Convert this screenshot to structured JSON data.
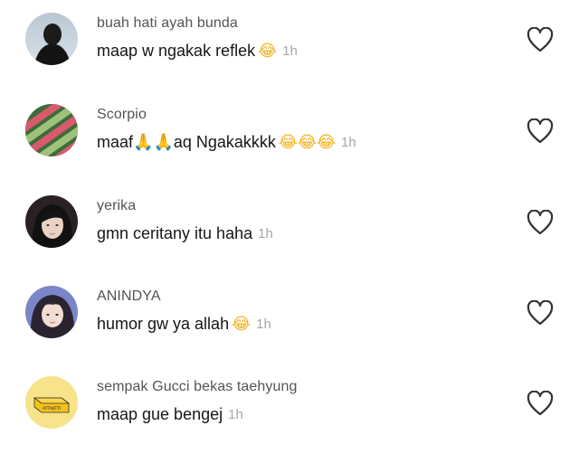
{
  "comments": [
    {
      "username": "buah hati ayah bunda",
      "text": "maap w ngakak reflek",
      "emoji": "😂",
      "time": "1h"
    },
    {
      "username": "Scorpio",
      "text_a": "maaf",
      "pray": "🙏🙏",
      "text_b": "aq Ngakakkkk",
      "emoji": "😂😂😂",
      "time": "1h"
    },
    {
      "username": "yerika",
      "text": "gmn ceritany itu haha",
      "time": "1h"
    },
    {
      "username": "ANINDYA",
      "text": "humor gw ya allah",
      "emoji": "😂",
      "time": "1h"
    },
    {
      "username": "sempak Gucci bekas taehyung",
      "text": "maap gue bengej",
      "time": "1h",
      "avatar_label": "ATTAKTTI"
    }
  ],
  "icons": {
    "like": "heart-outline-icon"
  },
  "colors": {
    "username": "#545454",
    "text": "#161616",
    "timestamp": "#a6a6a6",
    "heart": "#333333"
  }
}
